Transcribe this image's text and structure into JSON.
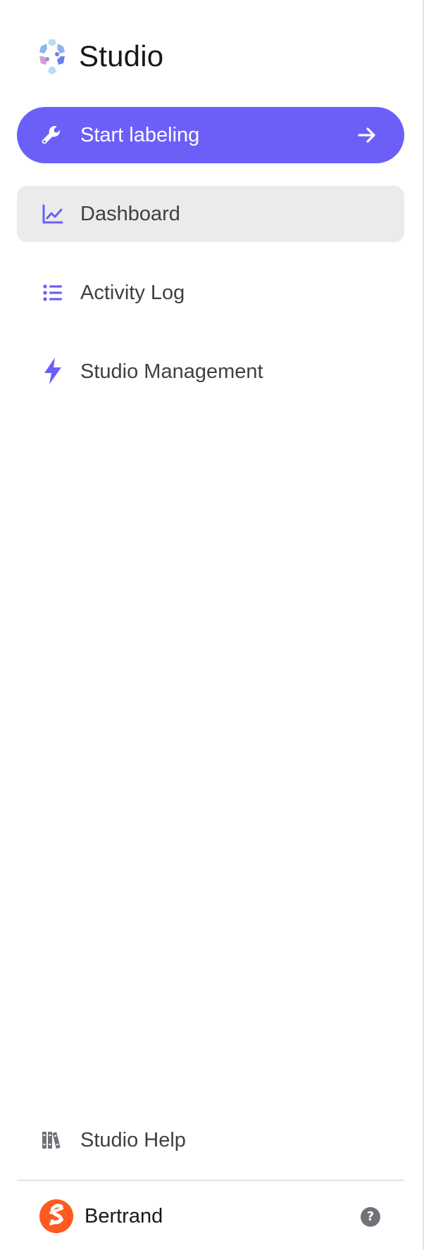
{
  "app": {
    "title": "Studio",
    "accent_color": "#6b5ff8"
  },
  "cta": {
    "label": "Start labeling",
    "icon_left": "wrench-icon",
    "icon_right": "arrow-right-icon"
  },
  "nav": {
    "items": [
      {
        "label": "Dashboard",
        "icon": "line-chart-icon",
        "active": true
      },
      {
        "label": "Activity Log",
        "icon": "list-icon",
        "active": false
      },
      {
        "label": "Studio Management",
        "icon": "lightning-icon",
        "active": false
      }
    ]
  },
  "footer": {
    "help_label": "Studio Help",
    "help_icon": "books-icon",
    "user_name": "Bertrand",
    "question_glyph": "?"
  }
}
